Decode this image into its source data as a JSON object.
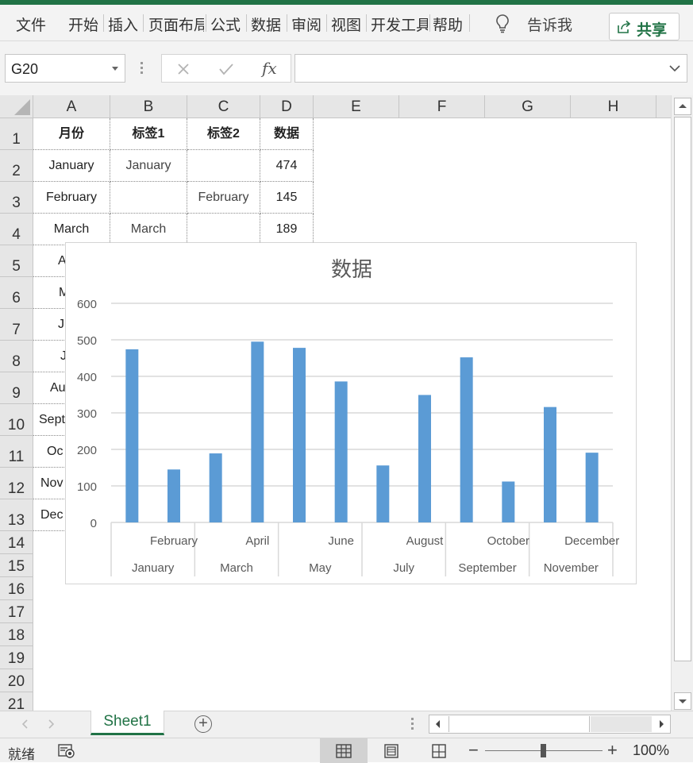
{
  "ribbon": {
    "tabs": [
      "文件",
      "开始",
      "插入",
      "页面布局",
      "公式",
      "数据",
      "审阅",
      "视图",
      "开发工具",
      "帮助"
    ],
    "tell_me": "告诉我",
    "share": "共享"
  },
  "formula_bar": {
    "name_box": "G20",
    "fx": "fx",
    "formula": ""
  },
  "columns": [
    "A",
    "B",
    "C",
    "D",
    "E",
    "F",
    "G",
    "H"
  ],
  "rows": [
    "1",
    "2",
    "3",
    "4",
    "5",
    "6",
    "7",
    "8",
    "9",
    "10",
    "11",
    "12",
    "13",
    "14",
    "15",
    "16",
    "17",
    "18",
    "19",
    "20",
    "21"
  ],
  "table": {
    "headers": [
      "月份",
      "标签1",
      "标签2",
      "数据"
    ],
    "rows": [
      [
        "January",
        "January",
        "",
        "474"
      ],
      [
        "February",
        "",
        "February",
        "145"
      ],
      [
        "March",
        "March",
        "",
        "189"
      ],
      [
        "A",
        "",
        "",
        ""
      ],
      [
        "M",
        "",
        "",
        ""
      ],
      [
        "Ju",
        "",
        "",
        ""
      ],
      [
        "J",
        "",
        "",
        ""
      ],
      [
        "Au",
        "",
        "",
        ""
      ],
      [
        "Sept",
        "",
        "",
        ""
      ],
      [
        "Oc",
        "",
        "",
        ""
      ],
      [
        "Nov",
        "",
        "",
        ""
      ],
      [
        "Dec",
        "",
        "",
        ""
      ]
    ]
  },
  "chart_data": {
    "type": "bar",
    "title": "数据",
    "categories": [
      "January",
      "February",
      "March",
      "April",
      "May",
      "June",
      "July",
      "August",
      "September",
      "October",
      "November",
      "December"
    ],
    "series": [
      {
        "values": [
          474,
          145,
          189,
          495,
          478,
          386,
          156,
          349,
          452,
          112,
          316,
          191
        ]
      }
    ],
    "label_row_upper": [
      "February",
      "April",
      "June",
      "August",
      "October",
      "December"
    ],
    "label_row_lower": [
      "January",
      "March",
      "May",
      "July",
      "September",
      "November"
    ],
    "yticks": [
      "0",
      "100",
      "200",
      "300",
      "400",
      "500",
      "600"
    ],
    "ylim": [
      0,
      600
    ],
    "grid": true,
    "legend": "none",
    "bar_color": "#5b9bd5"
  },
  "sheets": {
    "active": "Sheet1"
  },
  "status": {
    "ready": "就绪",
    "zoom": "100%"
  },
  "colors": {
    "accent": "#217346"
  }
}
